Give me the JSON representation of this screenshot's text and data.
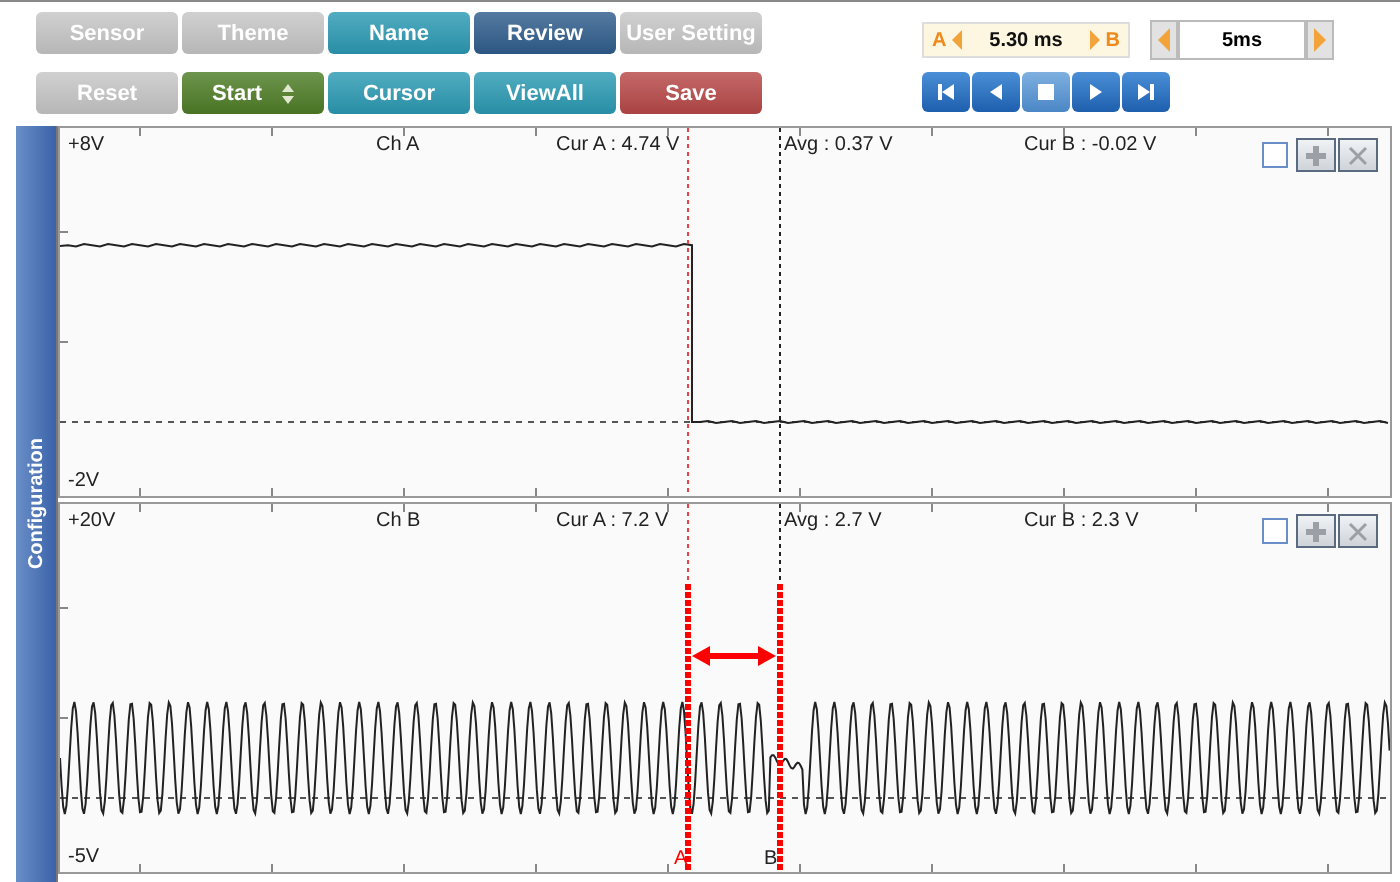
{
  "toolbar": {
    "buttons": [
      {
        "label": "Sensor",
        "color": "#c6c6c6",
        "kind": "button"
      },
      {
        "label": "Theme",
        "color": "#c6c6c6",
        "kind": "button"
      },
      {
        "label": "Name",
        "color": "#2b9ab3",
        "kind": "button"
      },
      {
        "label": "Review",
        "color": "#2f5d8c",
        "kind": "button"
      },
      {
        "label": "User Setting",
        "color": "#c6c6c6",
        "kind": "button"
      },
      {
        "label": "Reset",
        "color": "#c6c6c6",
        "kind": "button"
      },
      {
        "label": "Start",
        "color": "#4e7d26",
        "kind": "spinner"
      },
      {
        "label": "Cursor",
        "color": "#2b9ab3",
        "kind": "button"
      },
      {
        "label": "ViewAll",
        "color": "#2b9ab3",
        "kind": "button"
      },
      {
        "label": "Save",
        "color": "#b84848",
        "kind": "button"
      }
    ]
  },
  "cursor_readout": {
    "a_label": "A",
    "value": "5.30 ms",
    "b_label": "B"
  },
  "timebase": {
    "value": "5ms"
  },
  "sidebar_tab": {
    "label": "Configuration"
  },
  "channels": [
    {
      "kind": "step",
      "top": "+8V",
      "name": "Ch A",
      "cur_a": "Cur A : 4.74 V",
      "avg": "Avg : 0.37 V",
      "cur_b": "Cur B : -0.02 V",
      "bottom": "-2V",
      "checked": false
    },
    {
      "kind": "sine",
      "top": "+20V",
      "name": "Ch B",
      "cur_a": "Cur A : 7.2 V",
      "avg": "Avg : 2.7 V",
      "cur_b": "Cur B : 2.3 V",
      "bottom": "-5V",
      "checked": false,
      "cursor_labels": [
        "A",
        "B"
      ]
    }
  ]
}
